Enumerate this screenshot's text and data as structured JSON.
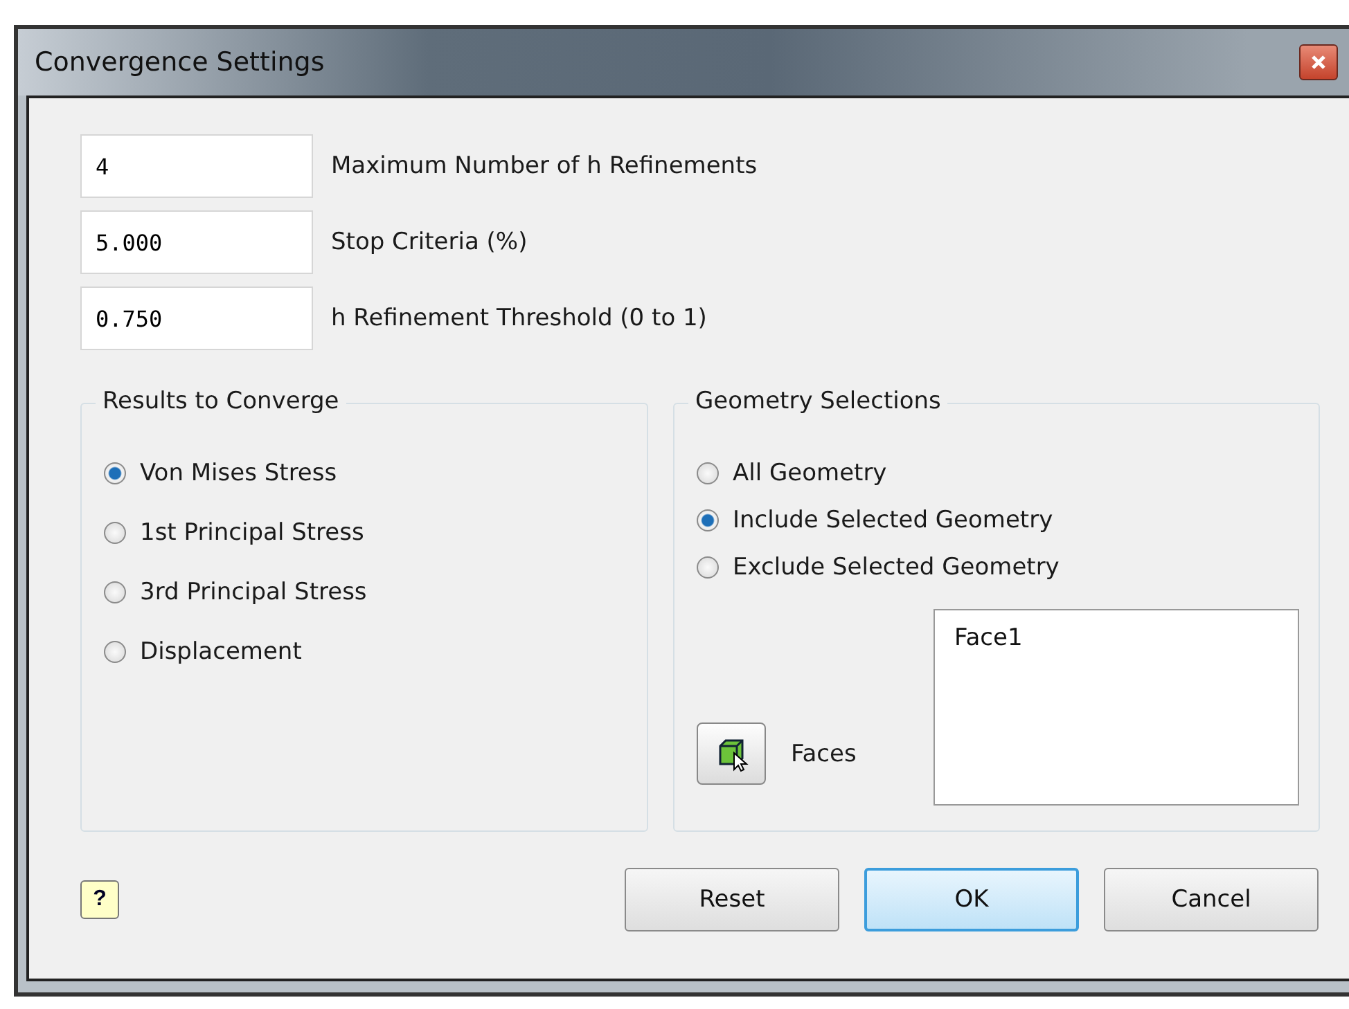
{
  "window": {
    "title": "Convergence Settings"
  },
  "fields": [
    {
      "value": "4",
      "label": "Maximum Number of h Refinements"
    },
    {
      "value": "5.000",
      "label": "Stop Criteria (%)"
    },
    {
      "value": "0.750",
      "label": "h Refinement Threshold (0 to 1)"
    }
  ],
  "results_group": {
    "title": "Results to Converge",
    "options": [
      {
        "label": "Von Mises Stress",
        "selected": true
      },
      {
        "label": "1st Principal Stress",
        "selected": false
      },
      {
        "label": "3rd Principal Stress",
        "selected": false
      },
      {
        "label": "Displacement",
        "selected": false
      }
    ]
  },
  "geometry_group": {
    "title": "Geometry Selections",
    "options": [
      {
        "label": "All Geometry",
        "selected": false
      },
      {
        "label": "Include Selected Geometry",
        "selected": true
      },
      {
        "label": "Exclude Selected Geometry",
        "selected": false
      }
    ],
    "faces_label": "Faces",
    "selection_list": [
      "Face1"
    ]
  },
  "help_button": {
    "label": "?"
  },
  "buttons": [
    {
      "label": "Reset",
      "default": false
    },
    {
      "label": "OK",
      "default": true
    },
    {
      "label": "Cancel",
      "default": false
    }
  ]
}
